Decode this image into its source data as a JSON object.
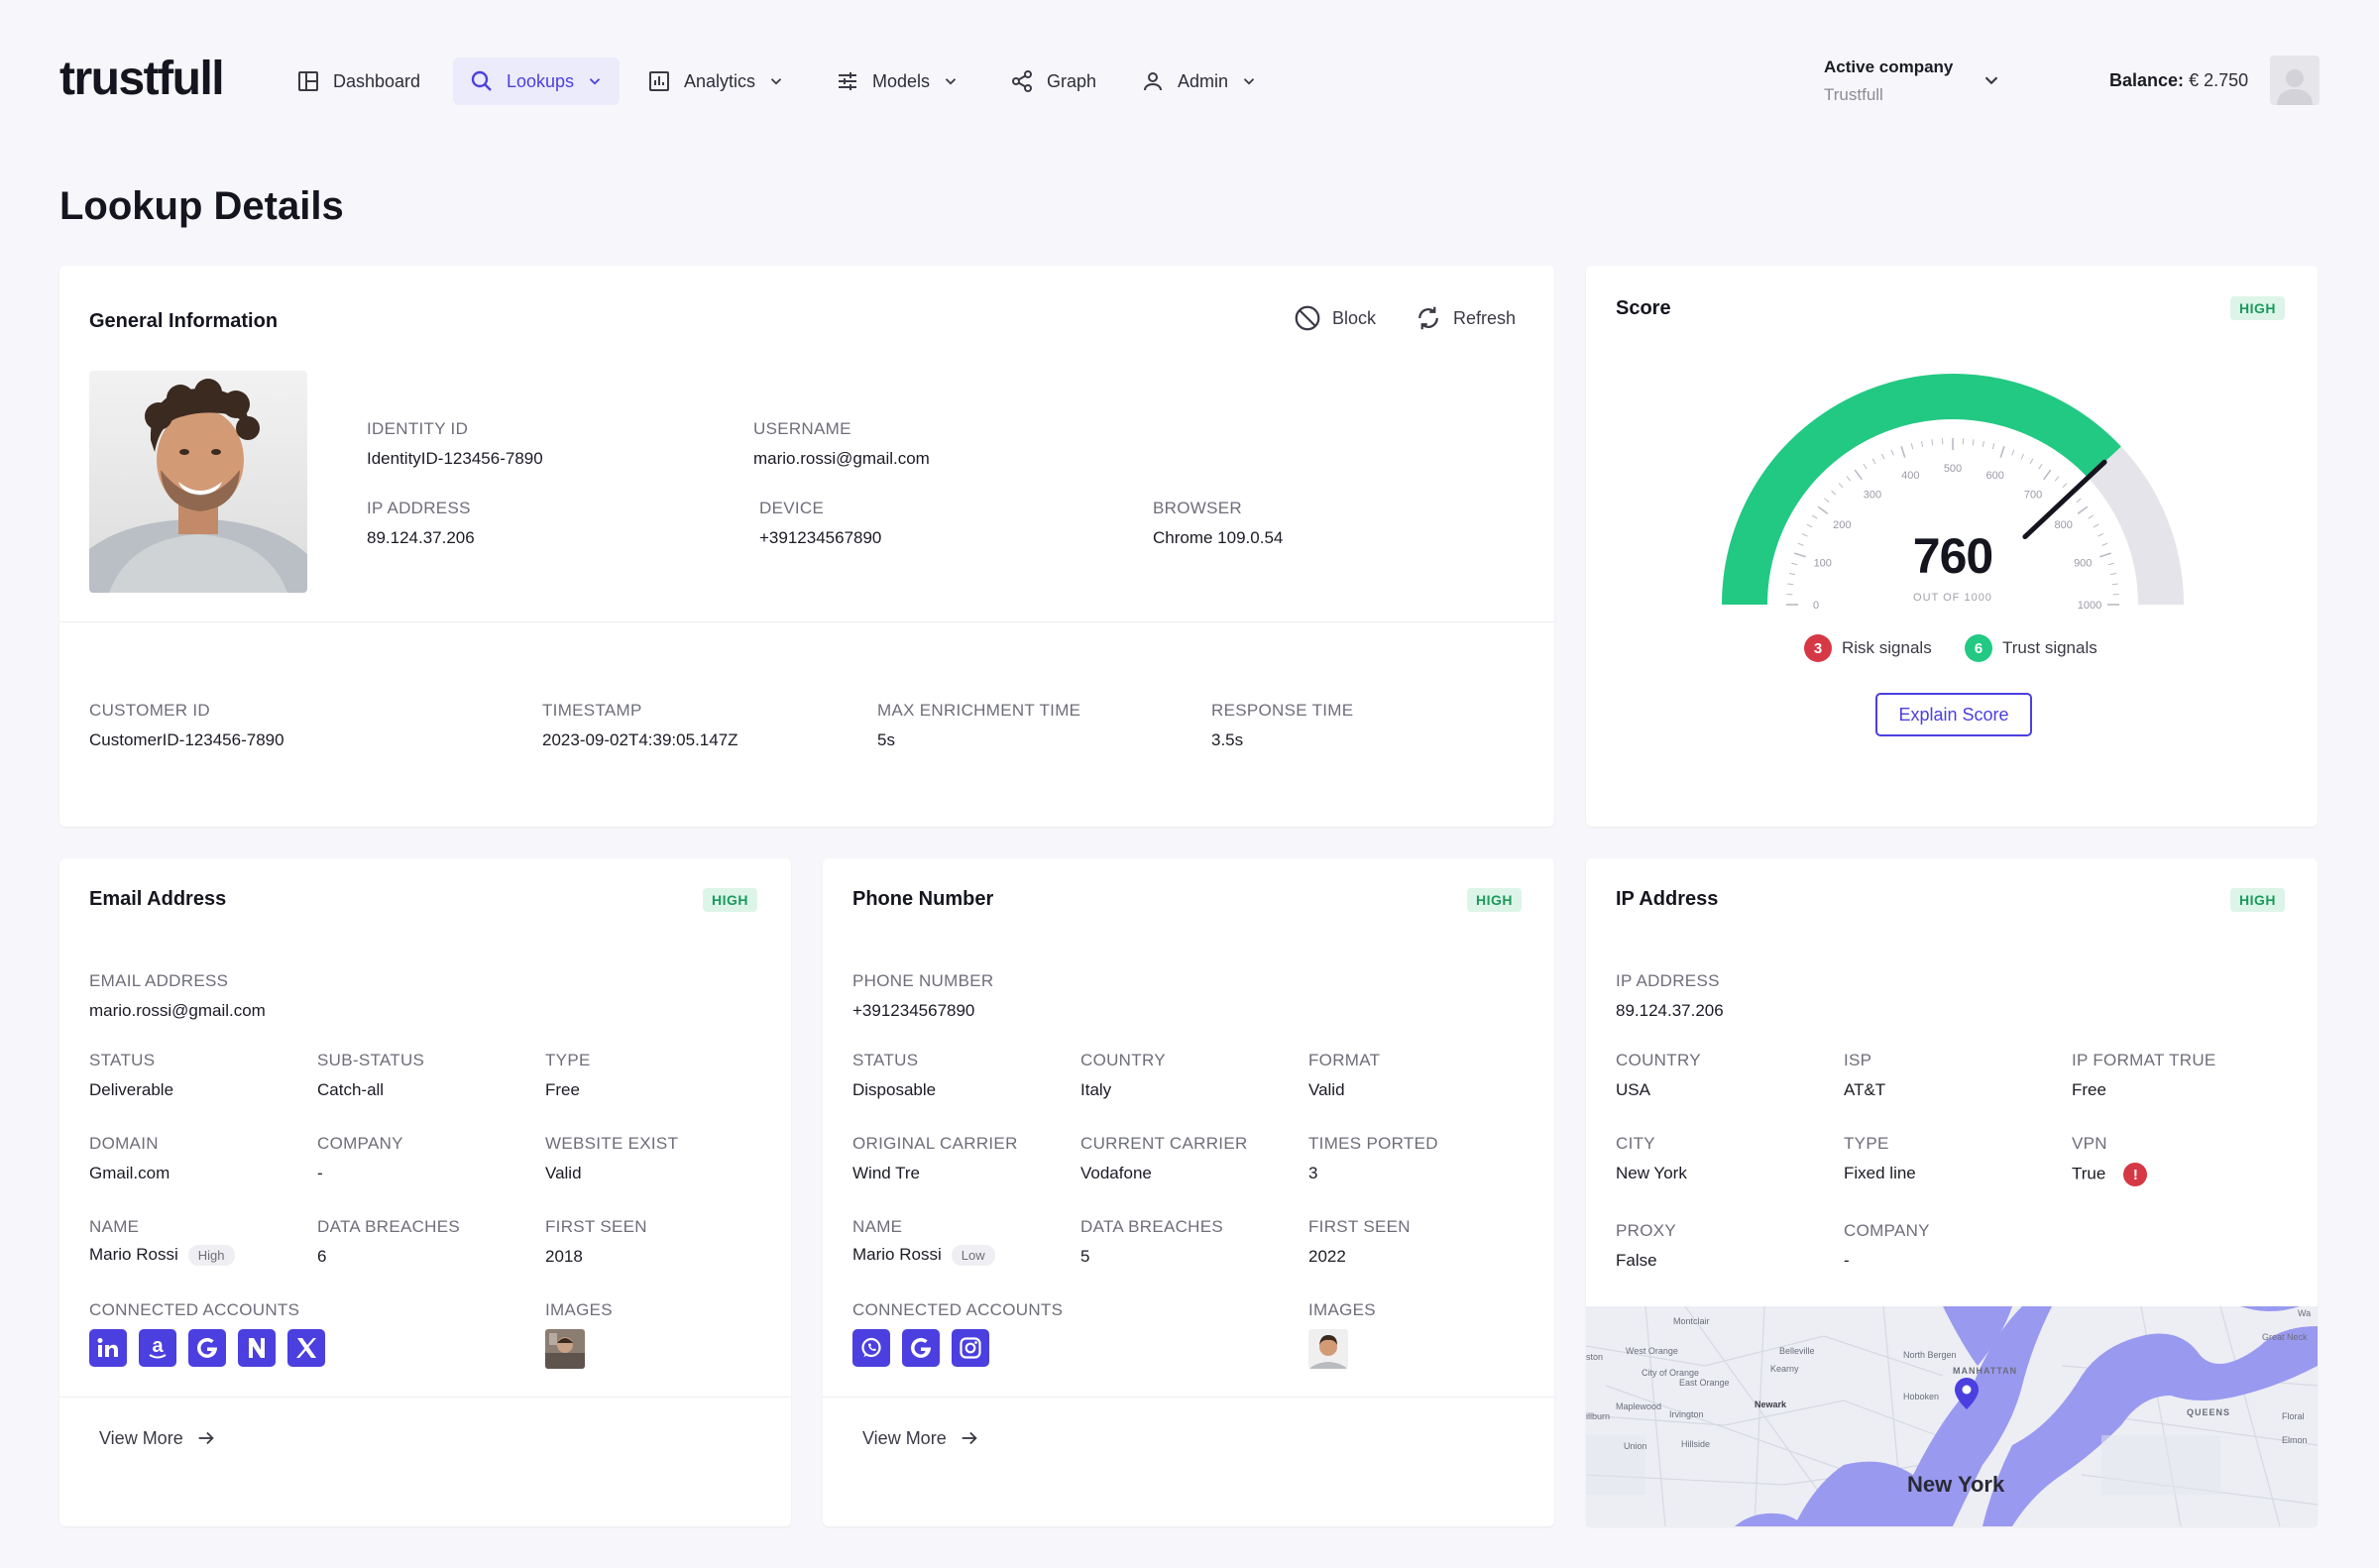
{
  "app": {
    "logo": "trustfull"
  },
  "nav": {
    "items": [
      {
        "label": "Dashboard"
      },
      {
        "label": "Lookups"
      },
      {
        "label": "Analytics"
      },
      {
        "label": "Models"
      },
      {
        "label": "Graph"
      },
      {
        "label": "Admin"
      }
    ],
    "company_label": "Active company",
    "company_value": "Trustfull",
    "balance_label": "Balance:",
    "balance_value": "€ 2.750"
  },
  "page": {
    "title": "Lookup Details"
  },
  "general": {
    "title": "General Information",
    "block_label": "Block",
    "refresh_label": "Refresh",
    "identity_id_label": "IDENTITY ID",
    "identity_id": "IdentityID-123456-7890",
    "username_label": "USERNAME",
    "username": "mario.rossi@gmail.com",
    "ip_label": "IP ADDRESS",
    "ip": "89.124.37.206",
    "device_label": "DEVICE",
    "device": "+391234567890",
    "browser_label": "BROWSER",
    "browser": "Chrome 109.0.54",
    "customer_id_label": "CUSTOMER ID",
    "customer_id": "CustomerID-123456-7890",
    "timestamp_label": "TIMESTAMP",
    "timestamp": "2023-09-02T4:39:05.147Z",
    "max_enrich_label": "MAX ENRICHMENT TIME",
    "max_enrich": "5s",
    "response_label": "RESPONSE TIME",
    "response": "3.5s"
  },
  "score": {
    "title": "Score",
    "badge": "HIGH",
    "value": "760",
    "out_of": "OUT OF 1000",
    "value_fraction": 0.76,
    "ticks": [
      "0",
      "100",
      "200",
      "300",
      "400",
      "500",
      "600",
      "700",
      "800",
      "900",
      "1000"
    ],
    "risk_count": "3",
    "risk_label": "Risk signals",
    "trust_count": "6",
    "trust_label": "Trust signals",
    "explain_label": "Explain Score",
    "colors": {
      "fill": "#22c983",
      "track": "#e4e4ea",
      "risk": "#d63845",
      "trust": "#22c983"
    }
  },
  "email": {
    "title": "Email Address",
    "badge": "HIGH",
    "email_label": "EMAIL ADDRESS",
    "email": "mario.rossi@gmail.com",
    "status_label": "STATUS",
    "status": "Deliverable",
    "substatus_label": "SUB-STATUS",
    "substatus": "Catch-all",
    "type_label": "TYPE",
    "type": "Free",
    "domain_label": "DOMAIN",
    "domain": "Gmail.com",
    "company_label": "COMPANY",
    "company": "-",
    "website_label": "WEBSITE EXIST",
    "website": "Valid",
    "name_label": "NAME",
    "name": "Mario Rossi",
    "name_pill": "High",
    "breaches_label": "DATA BREACHES",
    "breaches": "6",
    "first_seen_label": "FIRST SEEN",
    "first_seen": "2018",
    "accounts_label": "CONNECTED ACCOUNTS",
    "accounts": [
      "linkedin-icon",
      "amazon-icon",
      "google-icon",
      "notion-icon",
      "x-icon"
    ],
    "images_label": "IMAGES",
    "view_more": "View More"
  },
  "phone": {
    "title": "Phone Number",
    "badge": "HIGH",
    "phone_label": "PHONE NUMBER",
    "phone": "+391234567890",
    "status_label": "STATUS",
    "status": "Disposable",
    "country_label": "COUNTRY",
    "country": "Italy",
    "format_label": "FORMAT",
    "format": "Valid",
    "orig_label": "ORIGINAL CARRIER",
    "orig": "Wind Tre",
    "curr_label": "CURRENT CARRIER",
    "curr": "Vodafone",
    "ported_label": "TIMES PORTED",
    "ported": "3",
    "name_label": "NAME",
    "name": "Mario Rossi",
    "name_pill": "Low",
    "breaches_label": "DATA BREACHES",
    "breaches": "5",
    "first_seen_label": "FIRST SEEN",
    "first_seen": "2022",
    "accounts_label": "CONNECTED ACCOUNTS",
    "accounts": [
      "whatsapp-icon",
      "google-icon",
      "instagram-icon"
    ],
    "images_label": "IMAGES",
    "view_more": "View More"
  },
  "ipcard": {
    "title": "IP Address",
    "badge": "HIGH",
    "ip_label": "IP ADDRESS",
    "ip": "89.124.37.206",
    "country_label": "COUNTRY",
    "country": "USA",
    "isp_label": "ISP",
    "isp": "AT&T",
    "format_label": "IP FORMAT TRUE",
    "format": "Free",
    "city_label": "CITY",
    "city": "New York",
    "type_label": "TYPE",
    "type": "Fixed line",
    "vpn_label": "VPN",
    "vpn": "True",
    "proxy_label": "PROXY",
    "proxy": "False",
    "company_label": "COMPANY",
    "company": "-"
  },
  "map": {
    "city_label": "New York",
    "places": [
      "Montclair",
      "West Orange",
      "Belleville",
      "North Bergen",
      "City of Orange",
      "Kearny",
      "East Orange",
      "MANHATTAN",
      "Hoboken",
      "Newark",
      "Maplewood",
      "Irvington",
      "QUEENS",
      "Union",
      "Hillside",
      "Great Neck",
      "Floral",
      "Elmon",
      "ston",
      "illburn",
      "Wa"
    ]
  }
}
